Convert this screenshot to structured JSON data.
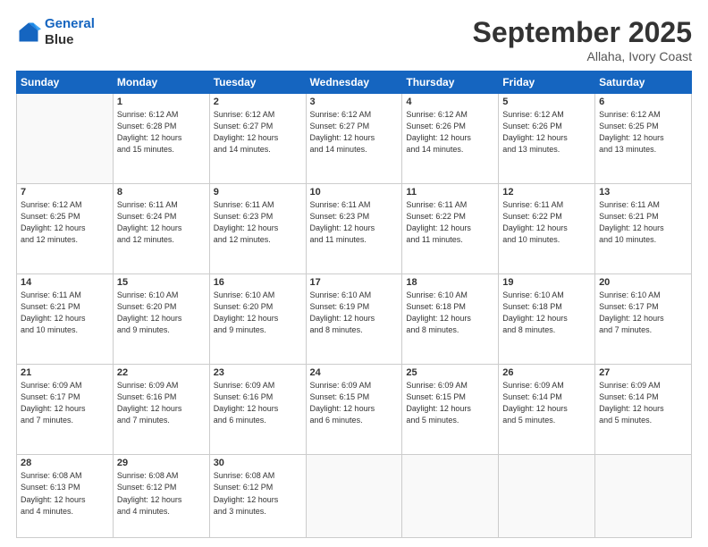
{
  "logo": {
    "line1": "General",
    "line2": "Blue"
  },
  "title": "September 2025",
  "subtitle": "Allaha, Ivory Coast",
  "days_of_week": [
    "Sunday",
    "Monday",
    "Tuesday",
    "Wednesday",
    "Thursday",
    "Friday",
    "Saturday"
  ],
  "weeks": [
    [
      {
        "day": "",
        "info": ""
      },
      {
        "day": "1",
        "info": "Sunrise: 6:12 AM\nSunset: 6:28 PM\nDaylight: 12 hours\nand 15 minutes."
      },
      {
        "day": "2",
        "info": "Sunrise: 6:12 AM\nSunset: 6:27 PM\nDaylight: 12 hours\nand 14 minutes."
      },
      {
        "day": "3",
        "info": "Sunrise: 6:12 AM\nSunset: 6:27 PM\nDaylight: 12 hours\nand 14 minutes."
      },
      {
        "day": "4",
        "info": "Sunrise: 6:12 AM\nSunset: 6:26 PM\nDaylight: 12 hours\nand 14 minutes."
      },
      {
        "day": "5",
        "info": "Sunrise: 6:12 AM\nSunset: 6:26 PM\nDaylight: 12 hours\nand 13 minutes."
      },
      {
        "day": "6",
        "info": "Sunrise: 6:12 AM\nSunset: 6:25 PM\nDaylight: 12 hours\nand 13 minutes."
      }
    ],
    [
      {
        "day": "7",
        "info": "Sunrise: 6:12 AM\nSunset: 6:25 PM\nDaylight: 12 hours\nand 12 minutes."
      },
      {
        "day": "8",
        "info": "Sunrise: 6:11 AM\nSunset: 6:24 PM\nDaylight: 12 hours\nand 12 minutes."
      },
      {
        "day": "9",
        "info": "Sunrise: 6:11 AM\nSunset: 6:23 PM\nDaylight: 12 hours\nand 12 minutes."
      },
      {
        "day": "10",
        "info": "Sunrise: 6:11 AM\nSunset: 6:23 PM\nDaylight: 12 hours\nand 11 minutes."
      },
      {
        "day": "11",
        "info": "Sunrise: 6:11 AM\nSunset: 6:22 PM\nDaylight: 12 hours\nand 11 minutes."
      },
      {
        "day": "12",
        "info": "Sunrise: 6:11 AM\nSunset: 6:22 PM\nDaylight: 12 hours\nand 10 minutes."
      },
      {
        "day": "13",
        "info": "Sunrise: 6:11 AM\nSunset: 6:21 PM\nDaylight: 12 hours\nand 10 minutes."
      }
    ],
    [
      {
        "day": "14",
        "info": "Sunrise: 6:11 AM\nSunset: 6:21 PM\nDaylight: 12 hours\nand 10 minutes."
      },
      {
        "day": "15",
        "info": "Sunrise: 6:10 AM\nSunset: 6:20 PM\nDaylight: 12 hours\nand 9 minutes."
      },
      {
        "day": "16",
        "info": "Sunrise: 6:10 AM\nSunset: 6:20 PM\nDaylight: 12 hours\nand 9 minutes."
      },
      {
        "day": "17",
        "info": "Sunrise: 6:10 AM\nSunset: 6:19 PM\nDaylight: 12 hours\nand 8 minutes."
      },
      {
        "day": "18",
        "info": "Sunrise: 6:10 AM\nSunset: 6:18 PM\nDaylight: 12 hours\nand 8 minutes."
      },
      {
        "day": "19",
        "info": "Sunrise: 6:10 AM\nSunset: 6:18 PM\nDaylight: 12 hours\nand 8 minutes."
      },
      {
        "day": "20",
        "info": "Sunrise: 6:10 AM\nSunset: 6:17 PM\nDaylight: 12 hours\nand 7 minutes."
      }
    ],
    [
      {
        "day": "21",
        "info": "Sunrise: 6:09 AM\nSunset: 6:17 PM\nDaylight: 12 hours\nand 7 minutes."
      },
      {
        "day": "22",
        "info": "Sunrise: 6:09 AM\nSunset: 6:16 PM\nDaylight: 12 hours\nand 7 minutes."
      },
      {
        "day": "23",
        "info": "Sunrise: 6:09 AM\nSunset: 6:16 PM\nDaylight: 12 hours\nand 6 minutes."
      },
      {
        "day": "24",
        "info": "Sunrise: 6:09 AM\nSunset: 6:15 PM\nDaylight: 12 hours\nand 6 minutes."
      },
      {
        "day": "25",
        "info": "Sunrise: 6:09 AM\nSunset: 6:15 PM\nDaylight: 12 hours\nand 5 minutes."
      },
      {
        "day": "26",
        "info": "Sunrise: 6:09 AM\nSunset: 6:14 PM\nDaylight: 12 hours\nand 5 minutes."
      },
      {
        "day": "27",
        "info": "Sunrise: 6:09 AM\nSunset: 6:14 PM\nDaylight: 12 hours\nand 5 minutes."
      }
    ],
    [
      {
        "day": "28",
        "info": "Sunrise: 6:08 AM\nSunset: 6:13 PM\nDaylight: 12 hours\nand 4 minutes."
      },
      {
        "day": "29",
        "info": "Sunrise: 6:08 AM\nSunset: 6:12 PM\nDaylight: 12 hours\nand 4 minutes."
      },
      {
        "day": "30",
        "info": "Sunrise: 6:08 AM\nSunset: 6:12 PM\nDaylight: 12 hours\nand 3 minutes."
      },
      {
        "day": "",
        "info": ""
      },
      {
        "day": "",
        "info": ""
      },
      {
        "day": "",
        "info": ""
      },
      {
        "day": "",
        "info": ""
      }
    ]
  ]
}
